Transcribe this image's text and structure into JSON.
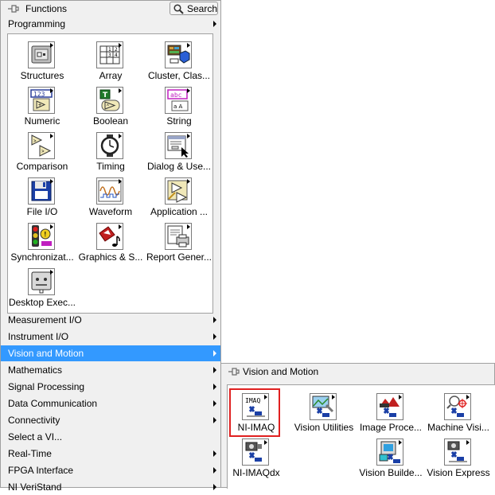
{
  "palette": {
    "title": "Functions",
    "search_label": "Search",
    "categories": [
      {
        "label": "Programming",
        "expanded": true
      },
      {
        "label": "Measurement I/O"
      },
      {
        "label": "Instrument I/O"
      },
      {
        "label": "Vision and Motion",
        "selected": true
      },
      {
        "label": "Mathematics"
      },
      {
        "label": "Signal Processing"
      },
      {
        "label": "Data Communication"
      },
      {
        "label": "Connectivity"
      },
      {
        "label": "Select a VI..."
      },
      {
        "label": "Real-Time"
      },
      {
        "label": "FPGA Interface"
      },
      {
        "label": "NI VeriStand"
      }
    ],
    "programming_items": [
      {
        "label": "Structures",
        "icon": "structures-icon"
      },
      {
        "label": "Array",
        "icon": "array-icon"
      },
      {
        "label": "Cluster, Clas...",
        "icon": "cluster-icon"
      },
      {
        "label": "Numeric",
        "icon": "numeric-icon"
      },
      {
        "label": "Boolean",
        "icon": "boolean-icon"
      },
      {
        "label": "String",
        "icon": "string-icon"
      },
      {
        "label": "Comparison",
        "icon": "comparison-icon"
      },
      {
        "label": "Timing",
        "icon": "timing-icon"
      },
      {
        "label": "Dialog & Use...",
        "icon": "dialog-icon"
      },
      {
        "label": "File I/O",
        "icon": "file-io-icon"
      },
      {
        "label": "Waveform",
        "icon": "waveform-icon"
      },
      {
        "label": "Application ...",
        "icon": "application-icon"
      },
      {
        "label": "Synchronizat...",
        "icon": "synchronization-icon"
      },
      {
        "label": "Graphics & S...",
        "icon": "graphics-sound-icon"
      },
      {
        "label": "Report Gener...",
        "icon": "report-icon"
      },
      {
        "label": "Desktop Exec...",
        "icon": "desktop-exec-icon"
      }
    ]
  },
  "subpalette": {
    "title": "Vision and Motion",
    "items": [
      {
        "label": "NI-IMAQ",
        "icon": "ni-imaq-icon",
        "icon_text": "IMAQ",
        "highlighted": true
      },
      {
        "label": "Vision Utilities",
        "icon": "vision-utilities-icon"
      },
      {
        "label": "Image Proce...",
        "icon": "image-processing-icon"
      },
      {
        "label": "Machine Visi...",
        "icon": "machine-vision-icon"
      },
      {
        "label": "NI-IMAQdx",
        "icon": "ni-imaqdx-icon"
      },
      {
        "label": "Vision Builde...",
        "icon": "vision-builder-icon"
      },
      {
        "label": "Vision Express",
        "icon": "vision-express-icon"
      }
    ]
  },
  "colors": {
    "selection": "#3399ff",
    "highlight_box": "#e02020",
    "panel_bg": "#f0f0f0"
  }
}
